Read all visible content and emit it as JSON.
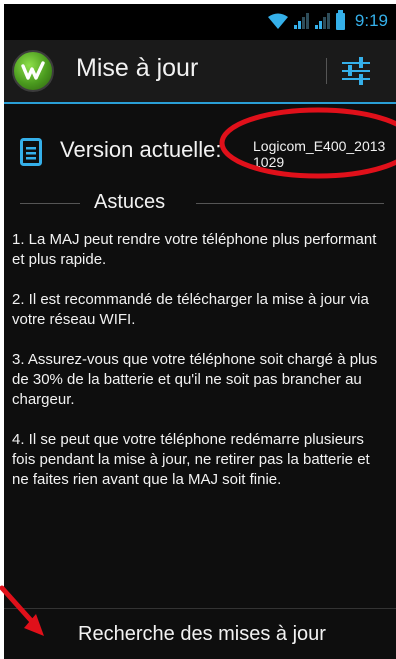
{
  "status_bar": {
    "time": "9:19",
    "icons": [
      "wifi-icon",
      "signal-icon",
      "signal-icon",
      "battery-icon"
    ],
    "accent": "#35b0ea"
  },
  "action_bar": {
    "title": "Mise à jour",
    "app_icon": "app-logo-icon",
    "menu_icon": "settings-sliders-icon",
    "accent": "#2a9fd6"
  },
  "version": {
    "label": "Version actuelle:",
    "value": "Logicom_E400_20131029",
    "icon": "document-icon"
  },
  "tips": {
    "title": "Astuces",
    "items": [
      "1. La MAJ peut rendre votre téléphone plus performant et plus rapide.",
      "2. Il est recommandé de télécharger la mise à jour via votre réseau WIFI.",
      "3. Assurez-vous que votre téléphone soit chargé à plus de 30% de la batterie et qu'il ne soit pas brancher au chargeur.",
      "4. Il se peut que votre téléphone redémarre plusieurs fois pendant la mise à jour, ne retirer pas la batterie et ne faites rien avant que la MAJ soit finie."
    ]
  },
  "check_button": {
    "label": "Recherche des mises à jour"
  },
  "annotations": {
    "color": "#e0101a"
  }
}
